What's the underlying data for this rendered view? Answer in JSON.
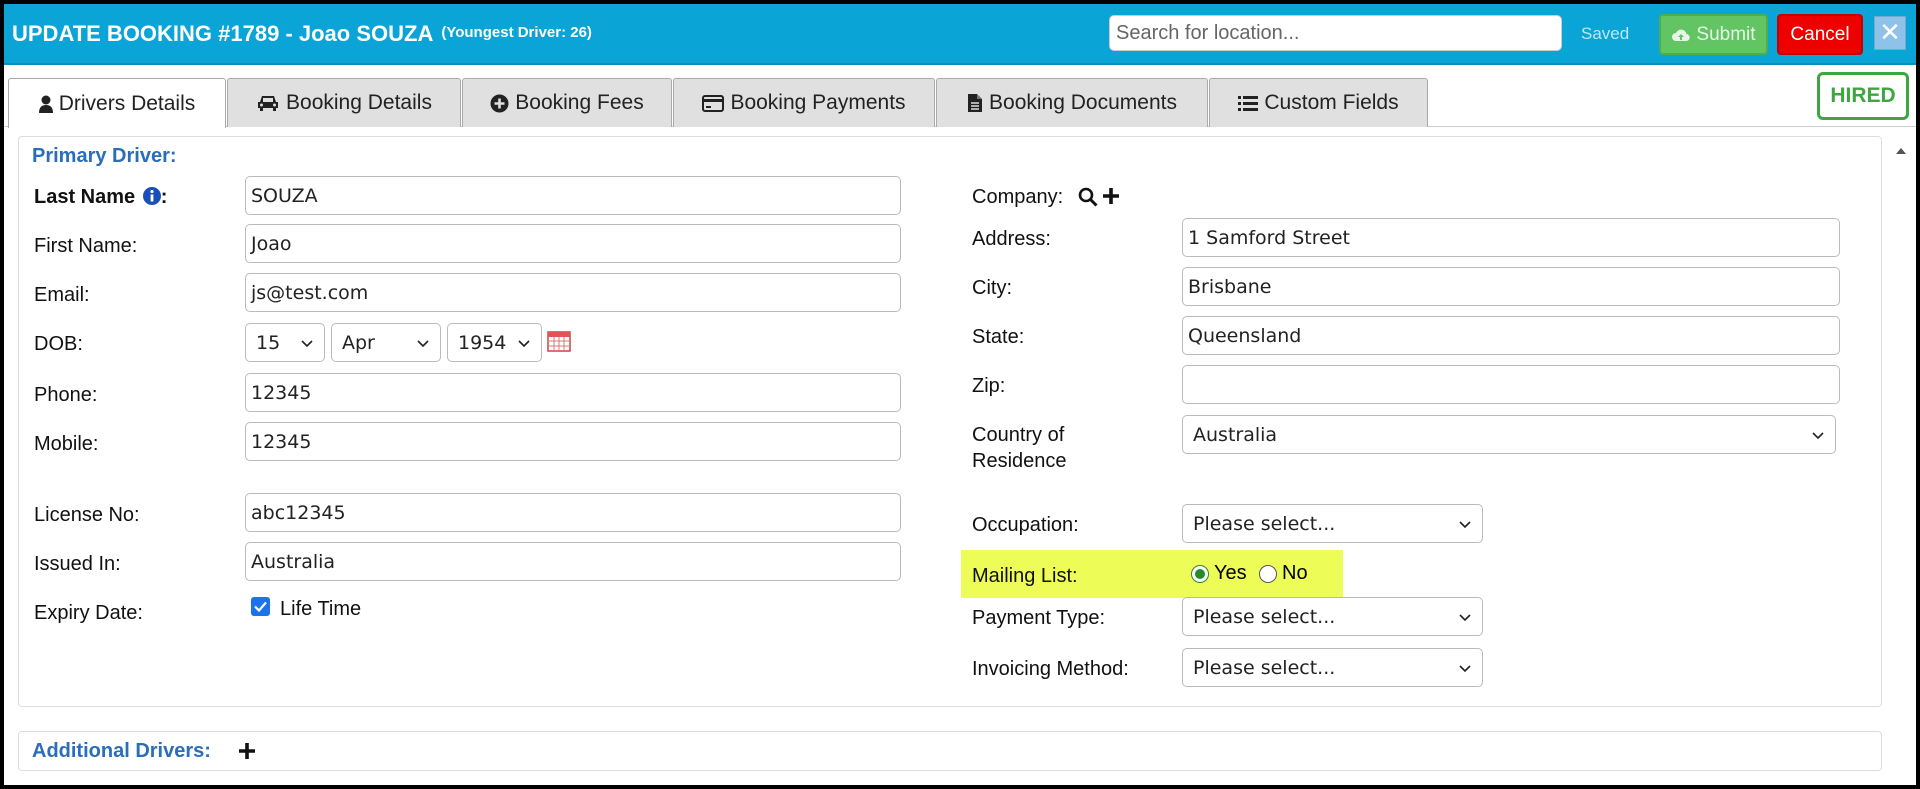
{
  "header": {
    "title": "UPDATE BOOKING #1789 - Joao SOUZA",
    "youngest_driver": "(Youngest Driver: 26)",
    "search_placeholder": "Search for location...",
    "saved_label": "Saved",
    "submit_label": "Submit",
    "cancel_label": "Cancel",
    "close_label": "✕"
  },
  "tabs": [
    {
      "label": "Drivers Details",
      "icon": "user-icon",
      "active": true
    },
    {
      "label": "Booking Details",
      "icon": "car-icon",
      "active": false
    },
    {
      "label": "Booking Fees",
      "icon": "plus-circle-icon",
      "active": false
    },
    {
      "label": "Booking Payments",
      "icon": "credit-card-icon",
      "active": false
    },
    {
      "label": "Booking Documents",
      "icon": "document-icon",
      "active": false
    },
    {
      "label": "Custom Fields",
      "icon": "list-icon",
      "active": false
    }
  ],
  "status_badge": "HIRED",
  "primary_driver": {
    "section_title": "Primary Driver:",
    "last_name_label": "Last Name",
    "last_name": "SOUZA",
    "first_name_label": "First Name:",
    "first_name": "Joao",
    "email_label": "Email:",
    "email": "js@test.com",
    "dob_label": "DOB:",
    "dob_day": "15",
    "dob_month": "Apr",
    "dob_year": "1954",
    "phone_label": "Phone:",
    "phone": "12345",
    "mobile_label": "Mobile:",
    "mobile": "12345",
    "license_label": "License No:",
    "license": "abc12345",
    "issued_label": "Issued In:",
    "issued": "Australia",
    "expiry_label": "Expiry Date:",
    "lifetime_label": "Life Time",
    "lifetime_checked": true,
    "company_label": "Company:",
    "address_label": "Address:",
    "address": "1 Samford Street",
    "city_label": "City:",
    "city": "Brisbane",
    "state_label": "State:",
    "state": "Queensland",
    "zip_label": "Zip:",
    "zip": "",
    "country_label_1": "Country of",
    "country_label_2": "Residence",
    "country": "Australia",
    "occupation_label": "Occupation:",
    "occupation": "Please select...",
    "mailing_label": "Mailing List:",
    "mailing_yes": "Yes",
    "mailing_no": "No",
    "mailing_selected": "Yes",
    "payment_label": "Payment Type:",
    "payment": "Please select...",
    "invoicing_label": "Invoicing Method:",
    "invoicing": "Please select..."
  },
  "additional_drivers": {
    "section_title": "Additional Drivers:"
  },
  "colors": {
    "header_bg": "#0aa4d6",
    "submit_bg": "#62c462",
    "cancel_bg": "#ee0000",
    "hired": "#3ea540",
    "section_title": "#2a6ebb",
    "highlight": "#eefc57"
  }
}
